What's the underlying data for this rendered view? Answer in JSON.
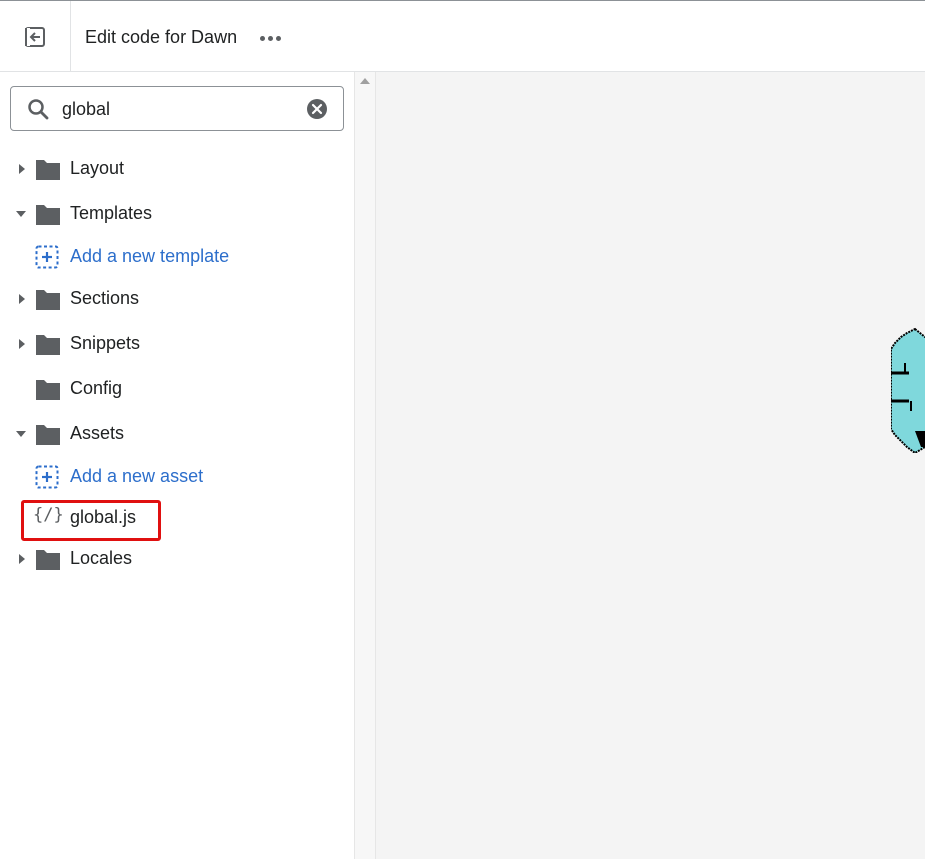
{
  "header": {
    "title": "Edit code for Dawn",
    "exit_icon": "exit-icon",
    "more_icon": "more-horizontal-icon"
  },
  "search": {
    "value": "global",
    "icon": "search-icon",
    "clear_icon": "clear-circle-icon"
  },
  "tree": {
    "layout": "Layout",
    "templates": "Templates",
    "add_template": "Add a new template",
    "sections": "Sections",
    "snippets": "Snippets",
    "config": "Config",
    "assets": "Assets",
    "add_asset": "Add a new asset",
    "file_global": "global.js",
    "file_icon_text": "{/}",
    "locales": "Locales"
  },
  "colors": {
    "link": "#2c6ecb",
    "folder": "#5c5f62",
    "highlight": "#e01010",
    "editor_bg": "#f4f4f4",
    "mascot": "#7fd8dc"
  }
}
